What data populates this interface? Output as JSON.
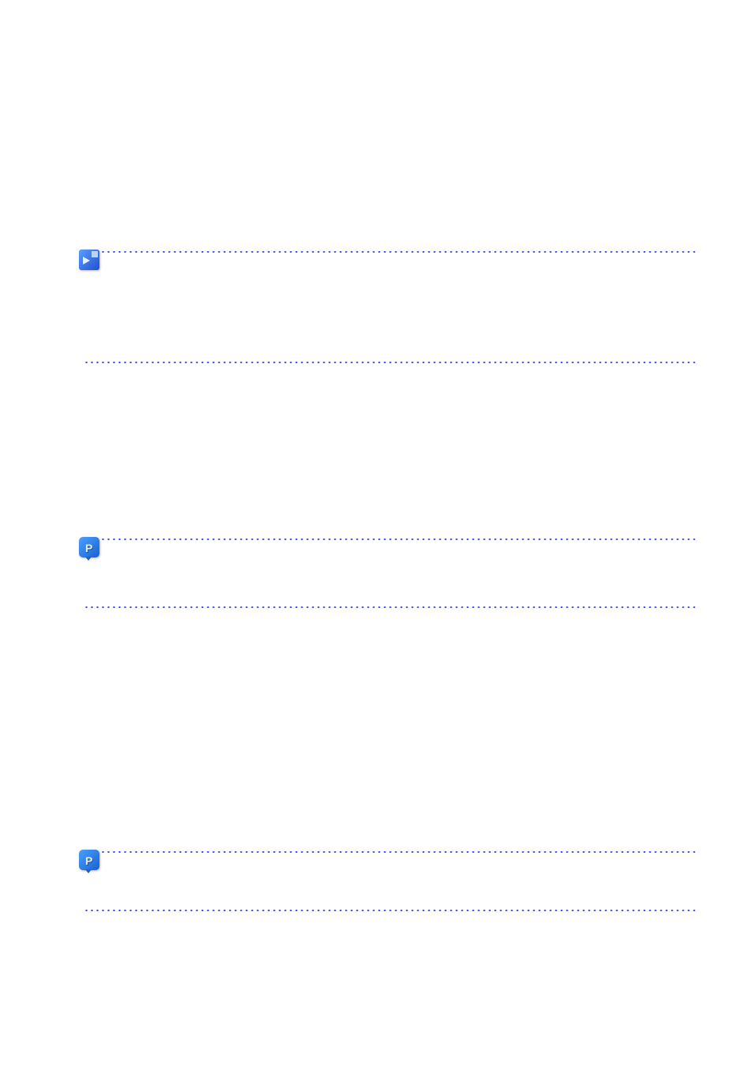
{
  "sections": [
    {
      "id": 1,
      "icon": "note-arrow-icon",
      "hasIcon": true
    },
    {
      "id": 2,
      "icon": null,
      "hasIcon": false
    },
    {
      "id": 3,
      "icon": "p-bubble-icon",
      "hasIcon": true,
      "letter": "P"
    },
    {
      "id": 4,
      "icon": null,
      "hasIcon": false
    },
    {
      "id": 5,
      "icon": "p-bubble-icon",
      "hasIcon": true,
      "letter": "P"
    },
    {
      "id": 6,
      "icon": null,
      "hasIcon": false
    }
  ]
}
